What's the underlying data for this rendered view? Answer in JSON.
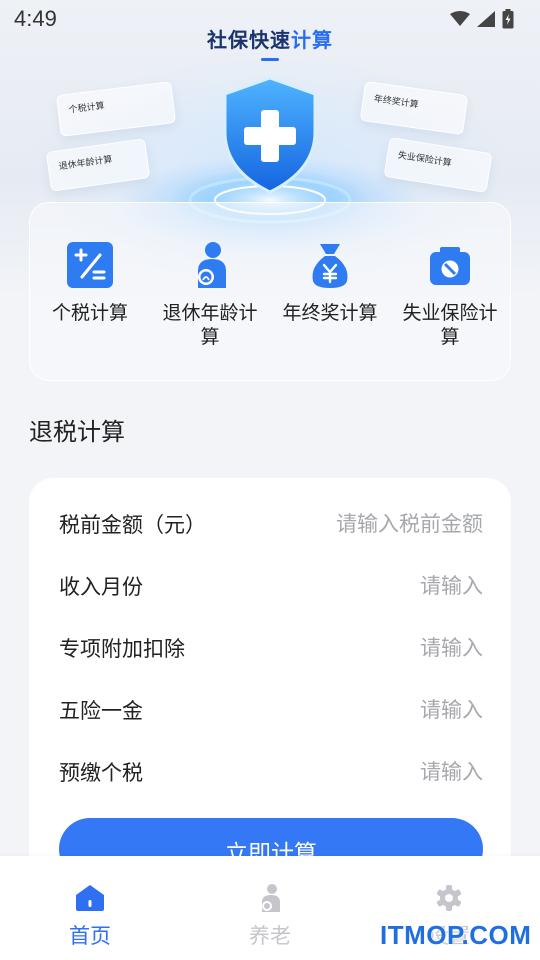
{
  "status_bar": {
    "time": "4:49"
  },
  "header": {
    "title_main": "社保快速",
    "title_accent": "计算"
  },
  "hero_cards": [
    "个税计算",
    "退休年龄计算",
    "年终奖计算",
    "失业保险计算"
  ],
  "quick_menu": [
    {
      "label": "个税计算",
      "icon": "tax-calc-icon"
    },
    {
      "label": "退休年龄计算",
      "icon": "elderly-person-icon"
    },
    {
      "label": "年终奖计算",
      "icon": "money-bag-icon"
    },
    {
      "label": "失业保险计算",
      "icon": "briefcase-icon"
    }
  ],
  "section": {
    "title": "退税计算"
  },
  "form": {
    "fields": [
      {
        "label": "税前金额（元）",
        "placeholder": "请输入税前金额"
      },
      {
        "label": "收入月份",
        "placeholder": "请输入"
      },
      {
        "label": "专项附加扣除",
        "placeholder": "请输入"
      },
      {
        "label": "五险一金",
        "placeholder": "请输入"
      },
      {
        "label": "预缴个税",
        "placeholder": "请输入"
      }
    ],
    "submit_label": "立即计算"
  },
  "bottom_nav": [
    {
      "label": "首页",
      "active": true,
      "icon": "home-icon"
    },
    {
      "label": "养老",
      "active": false,
      "icon": "elderly-icon"
    },
    {
      "label": "设置",
      "active": false,
      "icon": "gear-icon"
    }
  ],
  "watermark": "ITMOP.COM",
  "colors": {
    "primary": "#3478f6",
    "title": "#1b3470",
    "inactive": "#c4c6cb"
  }
}
